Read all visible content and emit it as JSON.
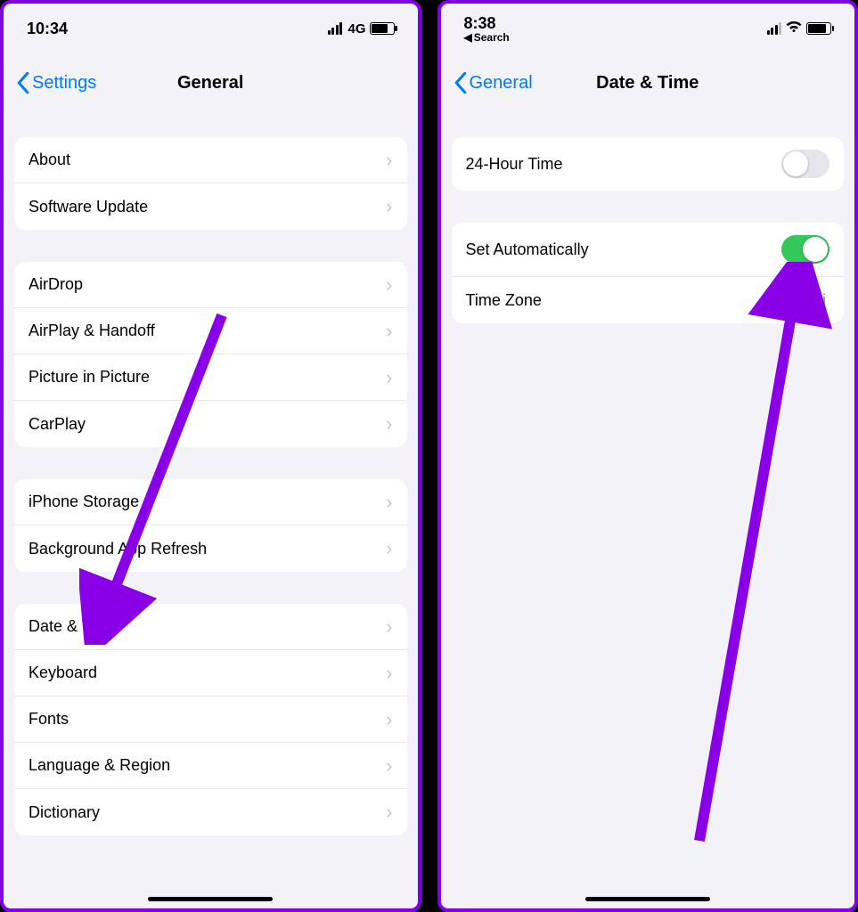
{
  "left": {
    "status": {
      "time": "10:34",
      "network": "4G"
    },
    "nav": {
      "back": "Settings",
      "title": "General"
    },
    "groups": [
      [
        {
          "key": "about",
          "label": "About"
        },
        {
          "key": "software-update",
          "label": "Software Update"
        }
      ],
      [
        {
          "key": "airdrop",
          "label": "AirDrop"
        },
        {
          "key": "airplay-handoff",
          "label": "AirPlay & Handoff"
        },
        {
          "key": "picture-in-picture",
          "label": "Picture in Picture"
        },
        {
          "key": "carplay",
          "label": "CarPlay"
        }
      ],
      [
        {
          "key": "iphone-storage",
          "label": "iPhone Storage"
        },
        {
          "key": "background-app-refresh",
          "label": "Background App Refresh"
        }
      ],
      [
        {
          "key": "date-time",
          "label": "Date & Time"
        },
        {
          "key": "keyboard",
          "label": "Keyboard"
        },
        {
          "key": "fonts",
          "label": "Fonts"
        },
        {
          "key": "language-region",
          "label": "Language & Region"
        },
        {
          "key": "dictionary",
          "label": "Dictionary"
        }
      ]
    ]
  },
  "right": {
    "status": {
      "time": "8:38",
      "back_search": "Search"
    },
    "nav": {
      "back": "General",
      "title": "Date & Time"
    },
    "rows": {
      "twenty_four_hour": {
        "label": "24-Hour Time",
        "on": false
      },
      "set_automatically": {
        "label": "Set Automatically",
        "on": true
      },
      "time_zone": {
        "label": "Time Zone",
        "value": "Mumbai"
      }
    }
  },
  "annotation_color": "#8a00e6"
}
